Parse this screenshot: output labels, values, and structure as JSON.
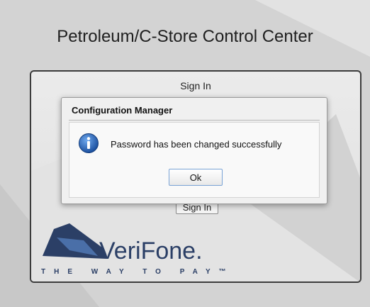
{
  "page": {
    "title": "Petroleum/C-Store Control Center"
  },
  "login": {
    "heading": "Sign In",
    "signin_label": "Sign In"
  },
  "brand": {
    "name": "VeriFone.",
    "tagline": "THE WAY TO PAY™",
    "color": "#2b3f66"
  },
  "dialog": {
    "title": "Configuration Manager",
    "icon": "info-icon",
    "message": "Password has been changed successfully",
    "ok_label": "Ok"
  }
}
